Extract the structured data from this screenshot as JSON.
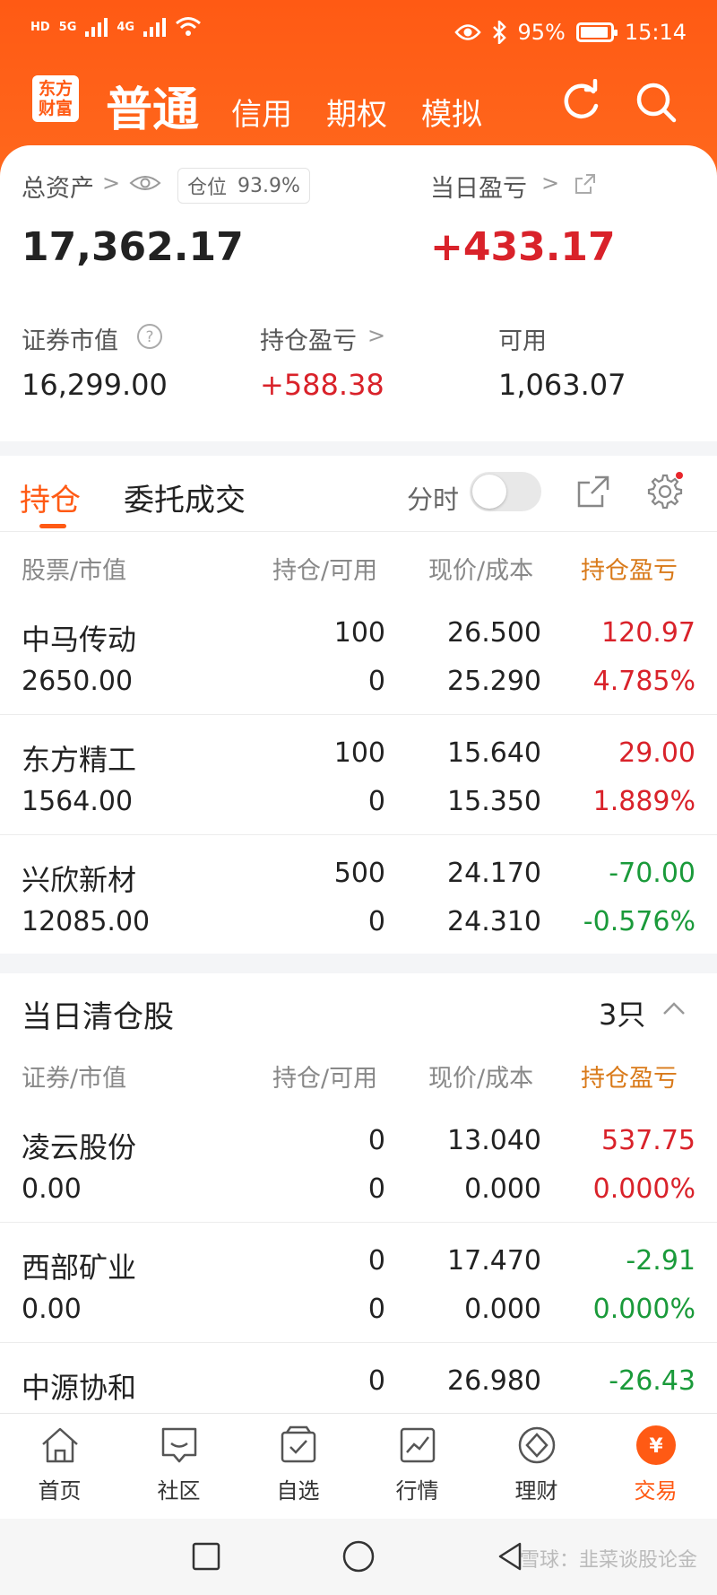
{
  "status_bar": {
    "left_labels": [
      "HD",
      "5G",
      "4G"
    ],
    "battery": "95%",
    "time": "15:14"
  },
  "header": {
    "logo_text": "东方财富",
    "tabs": [
      "普通",
      "信用",
      "期权",
      "模拟"
    ],
    "active_tab": "普通",
    "icons": [
      "refresh-icon",
      "search-icon"
    ]
  },
  "summary": {
    "total_assets_label": "总资产",
    "position_label": "仓位",
    "position_value": "93.9%",
    "total_assets_value": "17,362.17",
    "daily_pl_label": "当日盈亏",
    "daily_pl_value": "+433.17",
    "securities_value_label": "证券市值",
    "securities_value": "16,299.00",
    "holding_pl_label": "持仓盈亏",
    "holding_pl_value": "+588.38",
    "available_label": "可用",
    "available_value": "1,063.07"
  },
  "tabs": {
    "holdings": "持仓",
    "orders": "委托成交",
    "time_share": "分时"
  },
  "holdings": {
    "headers": [
      "股票/市值",
      "持仓/可用",
      "现价/成本",
      "持仓盈亏"
    ],
    "rows": [
      {
        "name": "中马传动",
        "market_value": "2650.00",
        "position": "100",
        "available": "0",
        "price": "26.500",
        "cost": "25.290",
        "pl": "120.97",
        "pl_pct": "4.785%",
        "trend": "up"
      },
      {
        "name": "东方精工",
        "market_value": "1564.00",
        "position": "100",
        "available": "0",
        "price": "15.640",
        "cost": "15.350",
        "pl": "29.00",
        "pl_pct": "1.889%",
        "trend": "up"
      },
      {
        "name": "兴欣新材",
        "market_value": "12085.00",
        "position": "500",
        "available": "0",
        "price": "24.170",
        "cost": "24.310",
        "pl": "-70.00",
        "pl_pct": "-0.576%",
        "trend": "down"
      }
    ]
  },
  "cleared": {
    "title": "当日清仓股",
    "count": "3只",
    "headers": [
      "证券/市值",
      "持仓/可用",
      "现价/成本",
      "持仓盈亏"
    ],
    "rows": [
      {
        "name": "凌云股份",
        "market_value": "0.00",
        "position": "0",
        "available": "0",
        "price": "13.040",
        "cost": "0.000",
        "pl": "537.75",
        "pl_pct": "0.000%",
        "trend": "up"
      },
      {
        "name": "西部矿业",
        "market_value": "0.00",
        "position": "0",
        "available": "0",
        "price": "17.470",
        "cost": "0.000",
        "pl": "-2.91",
        "pl_pct": "0.000%",
        "trend": "down"
      },
      {
        "name": "中源协和",
        "market_value": "",
        "position": "0",
        "available": "",
        "price": "26.980",
        "cost": "",
        "pl": "-26.43",
        "pl_pct": "",
        "trend": "down"
      }
    ]
  },
  "bottom_nav": [
    {
      "label": "首页",
      "icon": "home-icon"
    },
    {
      "label": "社区",
      "icon": "community-icon"
    },
    {
      "label": "自选",
      "icon": "watchlist-icon"
    },
    {
      "label": "行情",
      "icon": "market-icon"
    },
    {
      "label": "理财",
      "icon": "wealth-icon"
    },
    {
      "label": "交易",
      "icon": "trade-icon",
      "active": true
    }
  ],
  "colors": {
    "brand": "#ff5a14",
    "up": "#d9222a",
    "down": "#1a9a3a",
    "header_orange": "#d97a1a"
  },
  "watermark": "雪球：韭菜谈股论金"
}
